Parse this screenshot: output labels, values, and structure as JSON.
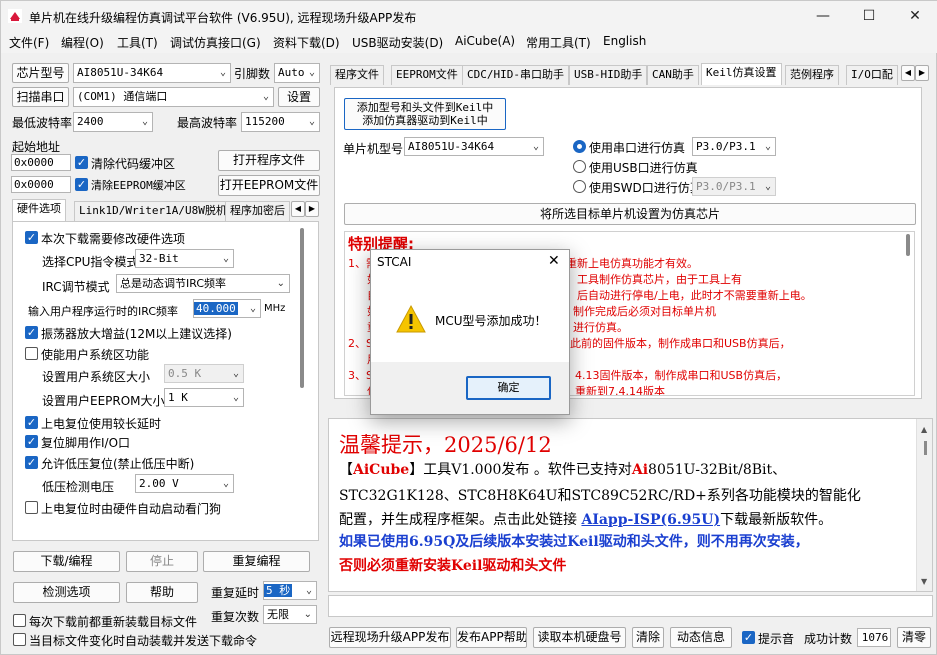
{
  "window": {
    "title": "单片机在线升级编程仿真调试平台软件 (V6.95U), 远程现场升级APP发布",
    "minimize": "—",
    "maximize": "☐",
    "close": "✕"
  },
  "menu": [
    "文件(F)",
    "编程(O)",
    "工具(T)",
    "调试仿真接口(G)",
    "资料下载(D)",
    "USB驱动安装(D)",
    "AiCube(A)",
    "常用工具(T)",
    "English"
  ],
  "left": {
    "chip_label": "芯片型号",
    "chip_value": "AI8051U-34K64",
    "pin_label": "引脚数",
    "pin_value": "Auto",
    "scan_btn": "扫描串口",
    "port_value": "(COM1) 通信端口",
    "settings_btn": "设置",
    "min_baud_label": "最低波特率",
    "min_baud": "2400",
    "max_baud_label": "最高波特率",
    "max_baud": "115200",
    "start_addr_label": "起始地址",
    "addr1": "0x0000",
    "clear_code": "清除代码缓冲区",
    "open_prog": "打开程序文件",
    "addr2": "0x0000",
    "clear_eeprom": "清除EEPROM缓冲区",
    "open_eeprom": "打开EEPROM文件",
    "tabs": [
      "硬件选项",
      "Link1D/Writer1A/U8W脱机",
      "程序加密后"
    ],
    "opts": {
      "modify_hw": "本次下载需要修改硬件选项",
      "cpu_mode_label": "选择CPU指令模式",
      "cpu_mode": "32-Bit",
      "irc_mode_label": "IRC调节模式",
      "irc_mode": "总是动态调节IRC频率",
      "irc_freq_label": "输入用户程序运行时的IRC频率",
      "irc_freq": "40.000",
      "irc_unit": "MHz",
      "amp_gain": "振荡器放大增益(12M以上建议选择)",
      "user_sys": "使能用户系统区功能",
      "user_sys_size_label": "设置用户系统区大小",
      "user_sys_size": "0.5 K",
      "user_eeprom_label": "设置用户EEPROM大小",
      "user_eeprom": "1   K",
      "long_delay": "上电复位使用较长延时",
      "reset_io": "复位脚用作I/O口",
      "low_volt_reset": "允许低压复位(禁止低压中断)",
      "low_volt_label": "低压检测电压",
      "low_volt": "2.00 V",
      "wdt": "上电复位时由硬件自动启动看门狗"
    },
    "download_btn": "下载/编程",
    "stop_btn": "停止",
    "reprog_btn": "重复编程",
    "detect_btn": "检测选项",
    "help_btn": "帮助",
    "repeat_delay_label": "重复延时",
    "repeat_delay": "5 秒",
    "repeat_count_label": "重复次数",
    "repeat_count": "无限",
    "reload_each": "每次下载前都重新装载目标文件",
    "auto_reload": "当目标文件变化时自动装载并发送下载命令"
  },
  "right": {
    "tabs": [
      "程序文件",
      "EEPROM文件",
      "CDC/HID-串口助手",
      "USB-HID助手",
      "CAN助手",
      "Keil仿真设置",
      "范例程序",
      "I/O口配"
    ],
    "keil_btn_line1": "添加型号和头文件到Keil中",
    "keil_btn_line2": "添加仿真器驱动到Keil中",
    "mcu_label": "单片机型号",
    "mcu_value": "AI8051U-34K64",
    "sim_serial": "使用串口进行仿真",
    "sim_serial_port": "P3.0/P3.1",
    "sim_usb": "使用USB口进行仿真",
    "sim_swd": "使用SWD口进行仿真",
    "sim_swd_port": "P3.0/P3.1",
    "set_chip_btn": "将所选目标单片机设置为仿真芯片",
    "notice_title": "特别提醒:",
    "notice_lines": [
      "1、需",
      "机重新上电仿真功能才有效。",
      "如",
      "工具制作仿真芯片，由于工具上有",
      "自",
      "后自动进行停电/上电，此时才不需要重新上电。",
      "如",
      "制作完成后必须对目标单片机",
      "重",
      "进行仿真。",
      "2、S",
      "此前的固件版本，制作成串口和USB仿真后，",
      "用",
      "3、S",
      "4.13固件版本，制作成串口和USB仿真后，",
      "使",
      "重新到7.4.14版本"
    ],
    "tips_title": "温馨提示，2025/6/12",
    "tips_l1a": "【",
    "tips_l1b": "AiCube",
    "tips_l1c": "】工具V1.000发布 。软件已支持对",
    "tips_l1d": "Ai",
    "tips_l1e": "8051U-32Bit/8Bit、",
    "tips_l2": "STC32G1K128、STC8H8K64U和STC89C52RC/RD+系列各功能模块的智能化",
    "tips_l3a": "配置，并生成程序框架。点击此处链接 ",
    "tips_l3b": "AIapp-ISP(6.95U)",
    "tips_l3c": "下载最新版软件。",
    "tips_l4": "如果已使用6.95Q及后续版本安装过Keil驱动和头文件，则不用再次安装，",
    "tips_l5": "否则必须重新安装Keil驱动和头文件",
    "bottom": {
      "remote_btn": "远程现场升级APP发布",
      "publish_help": "发布APP帮助",
      "read_disk": "读取本机硬盘号",
      "clear_btn": "清除",
      "dyn_info": "动态信息",
      "beep": "提示音",
      "success_label": "成功计数",
      "success_count": "1076",
      "clear_count": "清零"
    }
  },
  "dialog": {
    "title": "STCAI",
    "message": "MCU型号添加成功！",
    "ok": "确定",
    "close": "✕"
  },
  "colors": {
    "accent": "#1a66c4",
    "notice_red": "#e00000",
    "tips_blue": "#1a3fd0"
  }
}
